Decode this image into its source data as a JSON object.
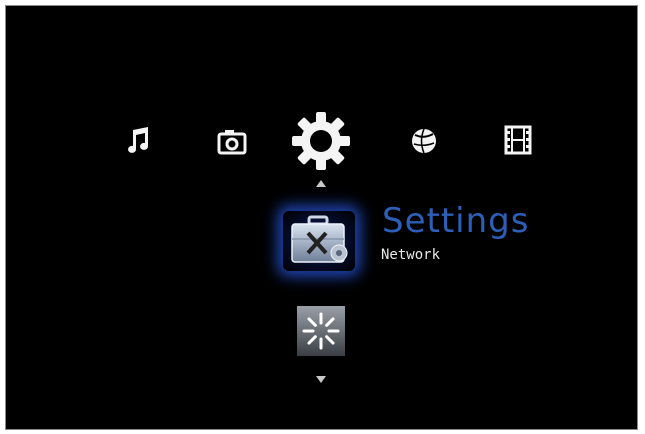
{
  "categories": [
    {
      "name": "music",
      "icon": "music-note-icon"
    },
    {
      "name": "photos",
      "icon": "camera-icon"
    },
    {
      "name": "settings",
      "icon": "gear-icon",
      "selected": true
    },
    {
      "name": "internet",
      "icon": "globe-icon"
    },
    {
      "name": "movies",
      "icon": "film-strip-icon"
    }
  ],
  "submenu": {
    "title": "Settings",
    "selected_item": "Network",
    "items": [
      {
        "icon": "toolbox-settings-icon",
        "selected": true
      },
      {
        "icon": "loading-spinner-icon",
        "selected": false
      }
    ],
    "up_icon": "up-arrow-icon",
    "down_icon": "down-arrow-icon"
  },
  "colors": {
    "background": "#000000",
    "title": "#2c5fb7",
    "subtitle": "#e9e9e9",
    "icon": "#f4f4f4",
    "highlight_glow": "#2a5ae6"
  }
}
